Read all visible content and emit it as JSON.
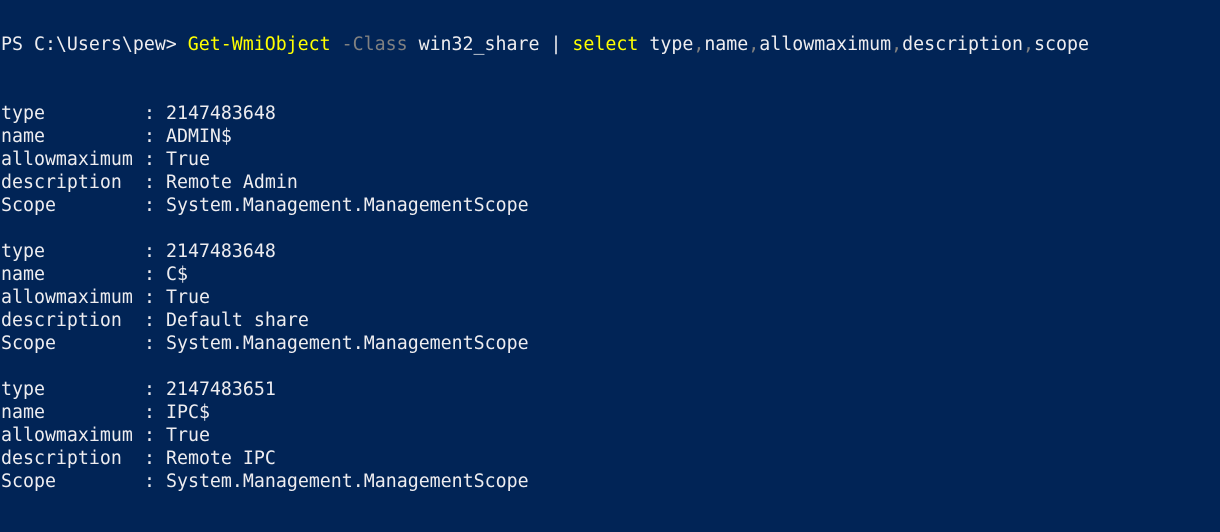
{
  "colors": {
    "background": "#012456",
    "text": "#eeedf0",
    "command": "#ffff00",
    "parameter": "#808080"
  },
  "command_line": {
    "prompt": "PS C:\\Users\\pew> ",
    "cmdlet": "Get-WmiObject",
    "sp1": " ",
    "param": "-Class",
    "sp2": " ",
    "param_value": "win32_share",
    "pipe": " | ",
    "select_cmd": "select",
    "sp3": " ",
    "fields": [
      {
        "name": "type",
        "sep": ","
      },
      {
        "name": "name",
        "sep": ","
      },
      {
        "name": "allowmaximum",
        "sep": ","
      },
      {
        "name": "description",
        "sep": ","
      },
      {
        "name": "scope",
        "sep": ""
      }
    ]
  },
  "results": [
    {
      "rows": [
        {
          "key": "type",
          "colon": ": ",
          "value": "2147483648"
        },
        {
          "key": "name",
          "colon": ": ",
          "value": "ADMIN$"
        },
        {
          "key": "allowmaximum",
          "colon": ": ",
          "value": "True"
        },
        {
          "key": "description",
          "colon": ": ",
          "value": "Remote Admin"
        },
        {
          "key": "Scope",
          "colon": ": ",
          "value": "System.Management.ManagementScope"
        }
      ]
    },
    {
      "rows": [
        {
          "key": "type",
          "colon": ": ",
          "value": "2147483648"
        },
        {
          "key": "name",
          "colon": ": ",
          "value": "C$"
        },
        {
          "key": "allowmaximum",
          "colon": ": ",
          "value": "True"
        },
        {
          "key": "description",
          "colon": ": ",
          "value": "Default share"
        },
        {
          "key": "Scope",
          "colon": ": ",
          "value": "System.Management.ManagementScope"
        }
      ]
    },
    {
      "rows": [
        {
          "key": "type",
          "colon": ": ",
          "value": "2147483651"
        },
        {
          "key": "name",
          "colon": ": ",
          "value": "IPC$"
        },
        {
          "key": "allowmaximum",
          "colon": ": ",
          "value": "True"
        },
        {
          "key": "description",
          "colon": ": ",
          "value": "Remote IPC"
        },
        {
          "key": "Scope",
          "colon": ": ",
          "value": "System.Management.ManagementScope"
        }
      ]
    }
  ]
}
